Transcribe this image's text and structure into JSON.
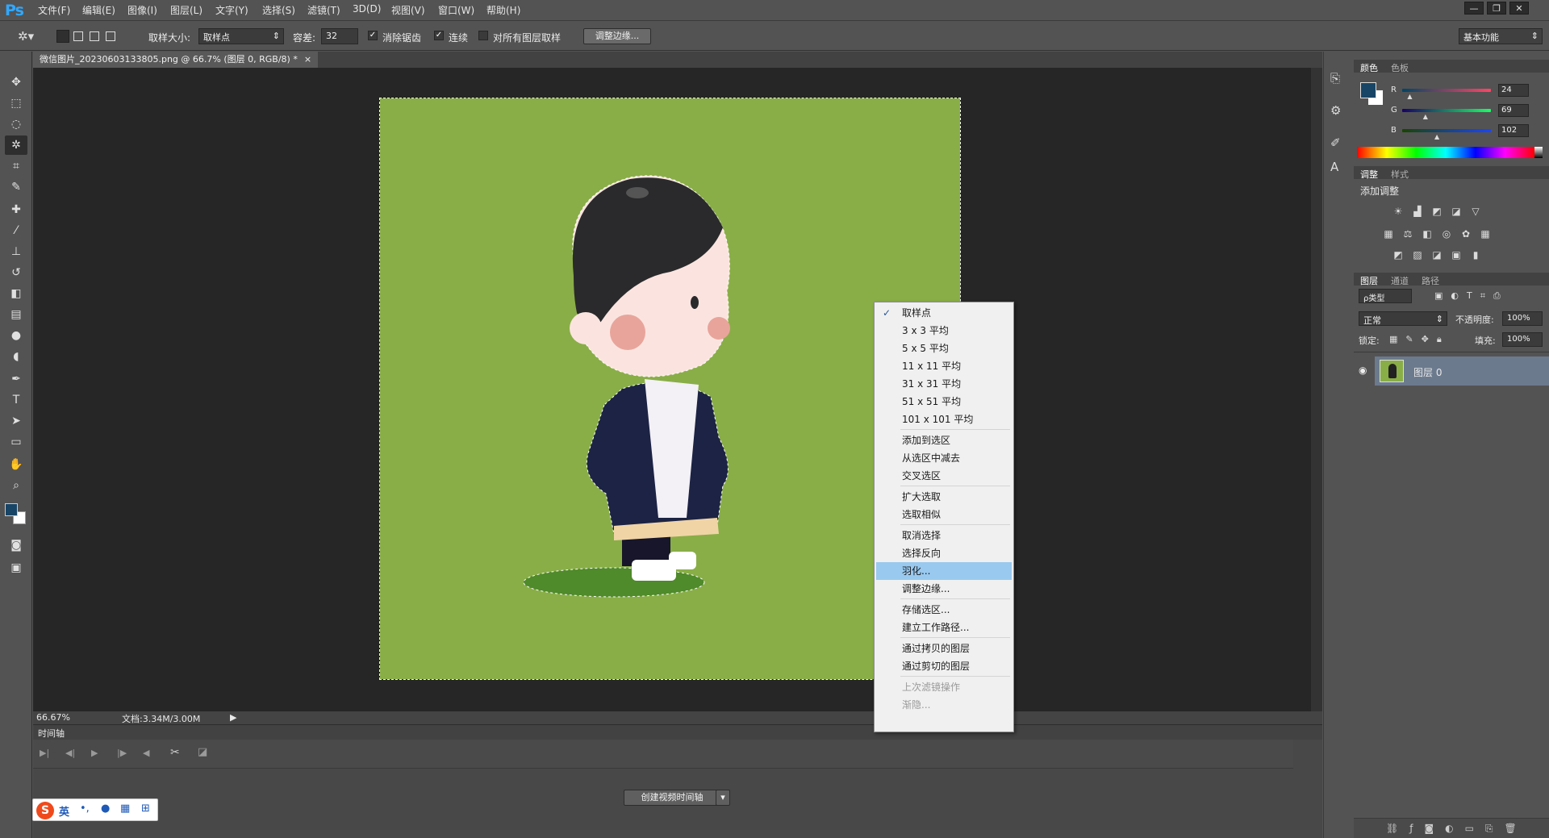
{
  "app": {
    "logo": "Ps"
  },
  "menu": [
    "文件(F)",
    "编辑(E)",
    "图像(I)",
    "图层(L)",
    "文字(Y)",
    "选择(S)",
    "滤镜(T)",
    "3D(D)",
    "视图(V)",
    "窗口(W)",
    "帮助(H)"
  ],
  "window_controls": {
    "minimize": "—",
    "restore": "❐",
    "close": "✕"
  },
  "options": {
    "sample_size_label": "取样大小:",
    "sample_size_value": "取样点",
    "tolerance_label": "容差:",
    "tolerance_value": "32",
    "anti_alias_label": "消除锯齿",
    "contiguous_label": "连续",
    "all_layers_label": "对所有图层取样",
    "refine_edge_button": "调整边缘...",
    "workspace": "基本功能"
  },
  "document": {
    "tab_title": "微信图片_20230603133805.png @ 66.7% (图层 0, RGB/8) *",
    "zoom": "66.67%",
    "doc_size": "文档:3.34M/3.00M",
    "canvas_color": "#89ae47"
  },
  "timeline": {
    "title": "时间轴",
    "create_button": "创建视频时间轴"
  },
  "context_menu": {
    "groups": [
      [
        {
          "label": "取样点",
          "checked": true
        },
        {
          "label": "3 x 3 平均"
        },
        {
          "label": "5 x 5 平均"
        },
        {
          "label": "11 x 11 平均"
        },
        {
          "label": "31 x 31 平均"
        },
        {
          "label": "51 x 51 平均"
        },
        {
          "label": "101 x 101 平均"
        }
      ],
      [
        {
          "label": "添加到选区"
        },
        {
          "label": "从选区中减去"
        },
        {
          "label": "交叉选区"
        }
      ],
      [
        {
          "label": "扩大选取"
        },
        {
          "label": "选取相似"
        }
      ],
      [
        {
          "label": "取消选择"
        },
        {
          "label": "选择反向"
        },
        {
          "label": "羽化...",
          "highlighted": true
        },
        {
          "label": "调整边缘..."
        }
      ],
      [
        {
          "label": "存储选区..."
        },
        {
          "label": "建立工作路径..."
        }
      ],
      [
        {
          "label": "通过拷贝的图层"
        },
        {
          "label": "通过剪切的图层"
        }
      ],
      [
        {
          "label": "上次滤镜操作",
          "disabled": true
        },
        {
          "label": "渐隐...",
          "disabled": true
        }
      ]
    ]
  },
  "color_panel": {
    "tabs": [
      "颜色",
      "色板"
    ],
    "r_label": "R",
    "g_label": "G",
    "b_label": "B",
    "r": 24,
    "g": 69,
    "b": 102,
    "foreground": "#184566"
  },
  "adjust_panel": {
    "tabs": [
      "调整",
      "样式"
    ],
    "add_label": "添加调整"
  },
  "layers_panel": {
    "tabs": [
      "图层",
      "通道",
      "路径"
    ],
    "filter_label": "ρ类型",
    "blend_mode": "正常",
    "opacity_label": "不透明度:",
    "opacity_value": "100%",
    "lock_label": "锁定:",
    "fill_label": "填充:",
    "fill_value": "100%",
    "layer_name": "图层 0"
  },
  "ime": {
    "lang": "英"
  }
}
